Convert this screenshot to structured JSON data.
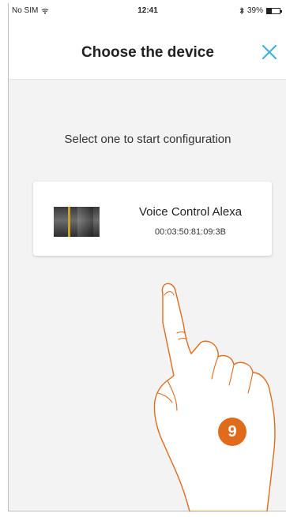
{
  "status_bar": {
    "carrier": "No SIM",
    "time": "12:41",
    "battery": "39%",
    "battery_level": 0.39
  },
  "header": {
    "title": "Choose the device",
    "close_icon": "close-icon"
  },
  "main": {
    "prompt": "Select one to start configuration"
  },
  "device": {
    "name": "Voice Control Alexa",
    "mac": "00:03:50:81:09:3B"
  },
  "tutorial": {
    "step": "9"
  },
  "colors": {
    "accent": "#3fb5d6",
    "step_badge": "#e06b1b",
    "hand_outline": "#e06b1b"
  }
}
